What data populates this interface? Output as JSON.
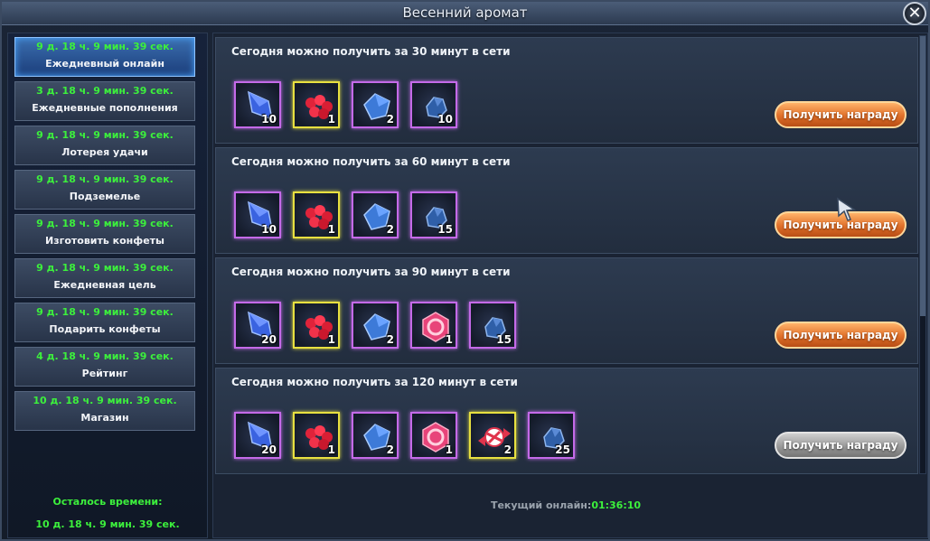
{
  "window": {
    "title": "Весенний аромат",
    "close_glyph": "✕"
  },
  "sidebar": {
    "items": [
      {
        "timer": "9 д. 18 ч. 9 мин. 39 сек.",
        "label": "Ежедневный онлайн",
        "active": true
      },
      {
        "timer": "3 д. 18 ч. 9 мин. 39 сек.",
        "label": "Ежедневные пополнения",
        "active": false
      },
      {
        "timer": "9 д. 18 ч. 9 мин. 39 сек.",
        "label": "Лотерея удачи",
        "active": false
      },
      {
        "timer": "9 д. 18 ч. 9 мин. 39 сек.",
        "label": "Подземелье",
        "active": false
      },
      {
        "timer": "9 д. 18 ч. 9 мин. 39 сек.",
        "label": "Изготовить конфеты",
        "active": false
      },
      {
        "timer": "9 д. 18 ч. 9 мин. 39 сек.",
        "label": "Ежедневная цель",
        "active": false
      },
      {
        "timer": "9 д. 18 ч. 9 мин. 39 сек.",
        "label": "Подарить конфеты",
        "active": false
      },
      {
        "timer": "4 д. 18 ч. 9 мин. 39 сек.",
        "label": "Рейтинг",
        "active": false
      },
      {
        "timer": "10 д. 18 ч. 9 мин. 39 сек.",
        "label": "Магазин",
        "active": false
      }
    ],
    "remaining_label": "Осталось времени:",
    "remaining_value": "10 д. 18 ч. 9 мин. 39 сек."
  },
  "rewards": {
    "claim_label": "Получить награду",
    "rows": [
      {
        "title": "Сегодня можно получить за 30 минут в сети",
        "claimable": true,
        "items": [
          {
            "icon": "blue-crystal-icon",
            "count": "10",
            "frame": "purple"
          },
          {
            "icon": "red-candy-pile-icon",
            "count": "1",
            "frame": "gold"
          },
          {
            "icon": "blue-gem-icon",
            "count": "2",
            "frame": "purple"
          },
          {
            "icon": "blue-ore-icon",
            "count": "10",
            "frame": "purple"
          }
        ]
      },
      {
        "title": "Сегодня можно получить за 60 минут в сети",
        "claimable": true,
        "items": [
          {
            "icon": "blue-crystal-icon",
            "count": "10",
            "frame": "purple"
          },
          {
            "icon": "red-candy-pile-icon",
            "count": "1",
            "frame": "gold"
          },
          {
            "icon": "blue-gem-icon",
            "count": "2",
            "frame": "purple"
          },
          {
            "icon": "blue-ore-icon",
            "count": "15",
            "frame": "purple"
          }
        ]
      },
      {
        "title": "Сегодня можно получить за 90 минут в сети",
        "claimable": true,
        "items": [
          {
            "icon": "blue-crystal-icon",
            "count": "20",
            "frame": "purple"
          },
          {
            "icon": "red-candy-pile-icon",
            "count": "1",
            "frame": "gold"
          },
          {
            "icon": "blue-gem-icon",
            "count": "2",
            "frame": "purple"
          },
          {
            "icon": "pink-candy-icon",
            "count": "1",
            "frame": "purple"
          },
          {
            "icon": "blue-ore-icon",
            "count": "15",
            "frame": "purple"
          }
        ]
      },
      {
        "title": "Сегодня можно получить за 120 минут в сети",
        "claimable": false,
        "items": [
          {
            "icon": "blue-crystal-icon",
            "count": "20",
            "frame": "purple"
          },
          {
            "icon": "red-candy-pile-icon",
            "count": "1",
            "frame": "gold"
          },
          {
            "icon": "blue-gem-icon",
            "count": "2",
            "frame": "purple"
          },
          {
            "icon": "pink-candy-icon",
            "count": "1",
            "frame": "purple"
          },
          {
            "icon": "wrapped-candy-icon",
            "count": "2",
            "frame": "gold"
          },
          {
            "icon": "blue-ore-icon",
            "count": "25",
            "frame": "purple"
          }
        ]
      }
    ]
  },
  "status": {
    "online_label": "Текущий онлайн:",
    "online_value": "01:36:10"
  }
}
